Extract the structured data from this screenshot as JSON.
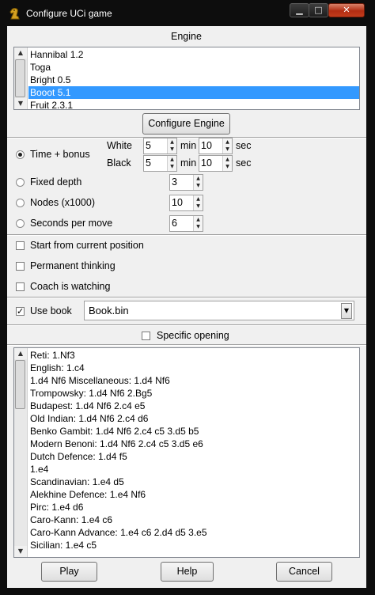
{
  "window": {
    "title": "Configure UCi game",
    "icon": "knight-icon",
    "controls": {
      "minimize": "▁",
      "maximize": "□",
      "close": "✕"
    }
  },
  "engine": {
    "header": "Engine",
    "list": [
      "Hannibal 1.2",
      "Toga",
      "Bright 0.5",
      "Booot 5.1",
      "Fruit 2.3.1"
    ],
    "selected": "Booot 5.1",
    "configure_button": "Configure Engine"
  },
  "time_mode": {
    "time_bonus": {
      "label": "Time + bonus",
      "selected": true,
      "white_label": "White",
      "black_label": "Black",
      "white_min": "5",
      "white_sec": "10",
      "black_min": "5",
      "black_sec": "10",
      "min_unit": "min",
      "sec_unit": "sec"
    },
    "fixed_depth": {
      "label": "Fixed depth",
      "value": "3"
    },
    "nodes": {
      "label": "Nodes (x1000)",
      "value": "10"
    },
    "seconds_per_move": {
      "label": "Seconds per move",
      "value": "6"
    }
  },
  "options": {
    "start_current": {
      "label": "Start from current position",
      "checked": false
    },
    "permanent_thinking": {
      "label": "Permanent thinking",
      "checked": false
    },
    "coach": {
      "label": "Coach is watching",
      "checked": false
    }
  },
  "book": {
    "use_book_label": "Use book",
    "use_book_checked": true,
    "book_file": "Book.bin",
    "specific_opening_label": "Specific opening",
    "specific_opening_checked": false
  },
  "openings": [
    "Reti: 1.Nf3",
    "English: 1.c4",
    "1.d4 Nf6 Miscellaneous: 1.d4 Nf6",
    "Trompowsky: 1.d4 Nf6 2.Bg5",
    "Budapest: 1.d4 Nf6 2.c4 e5",
    "Old Indian: 1.d4 Nf6 2.c4 d6",
    "Benko Gambit: 1.d4 Nf6 2.c4 c5 3.d5 b5",
    "Modern Benoni: 1.d4 Nf6 2.c4 c5 3.d5 e6",
    "Dutch Defence: 1.d4 f5",
    "1.e4",
    "Scandinavian: 1.e4 d5",
    "Alekhine Defence: 1.e4 Nf6",
    "Pirc: 1.e4 d6",
    "Caro-Kann: 1.e4 c6",
    "Caro-Kann Advance: 1.e4 c6 2.d4 d5 3.e5",
    "Sicilian: 1.e4 c5"
  ],
  "buttons": {
    "play": "Play",
    "help": "Help",
    "cancel": "Cancel"
  }
}
